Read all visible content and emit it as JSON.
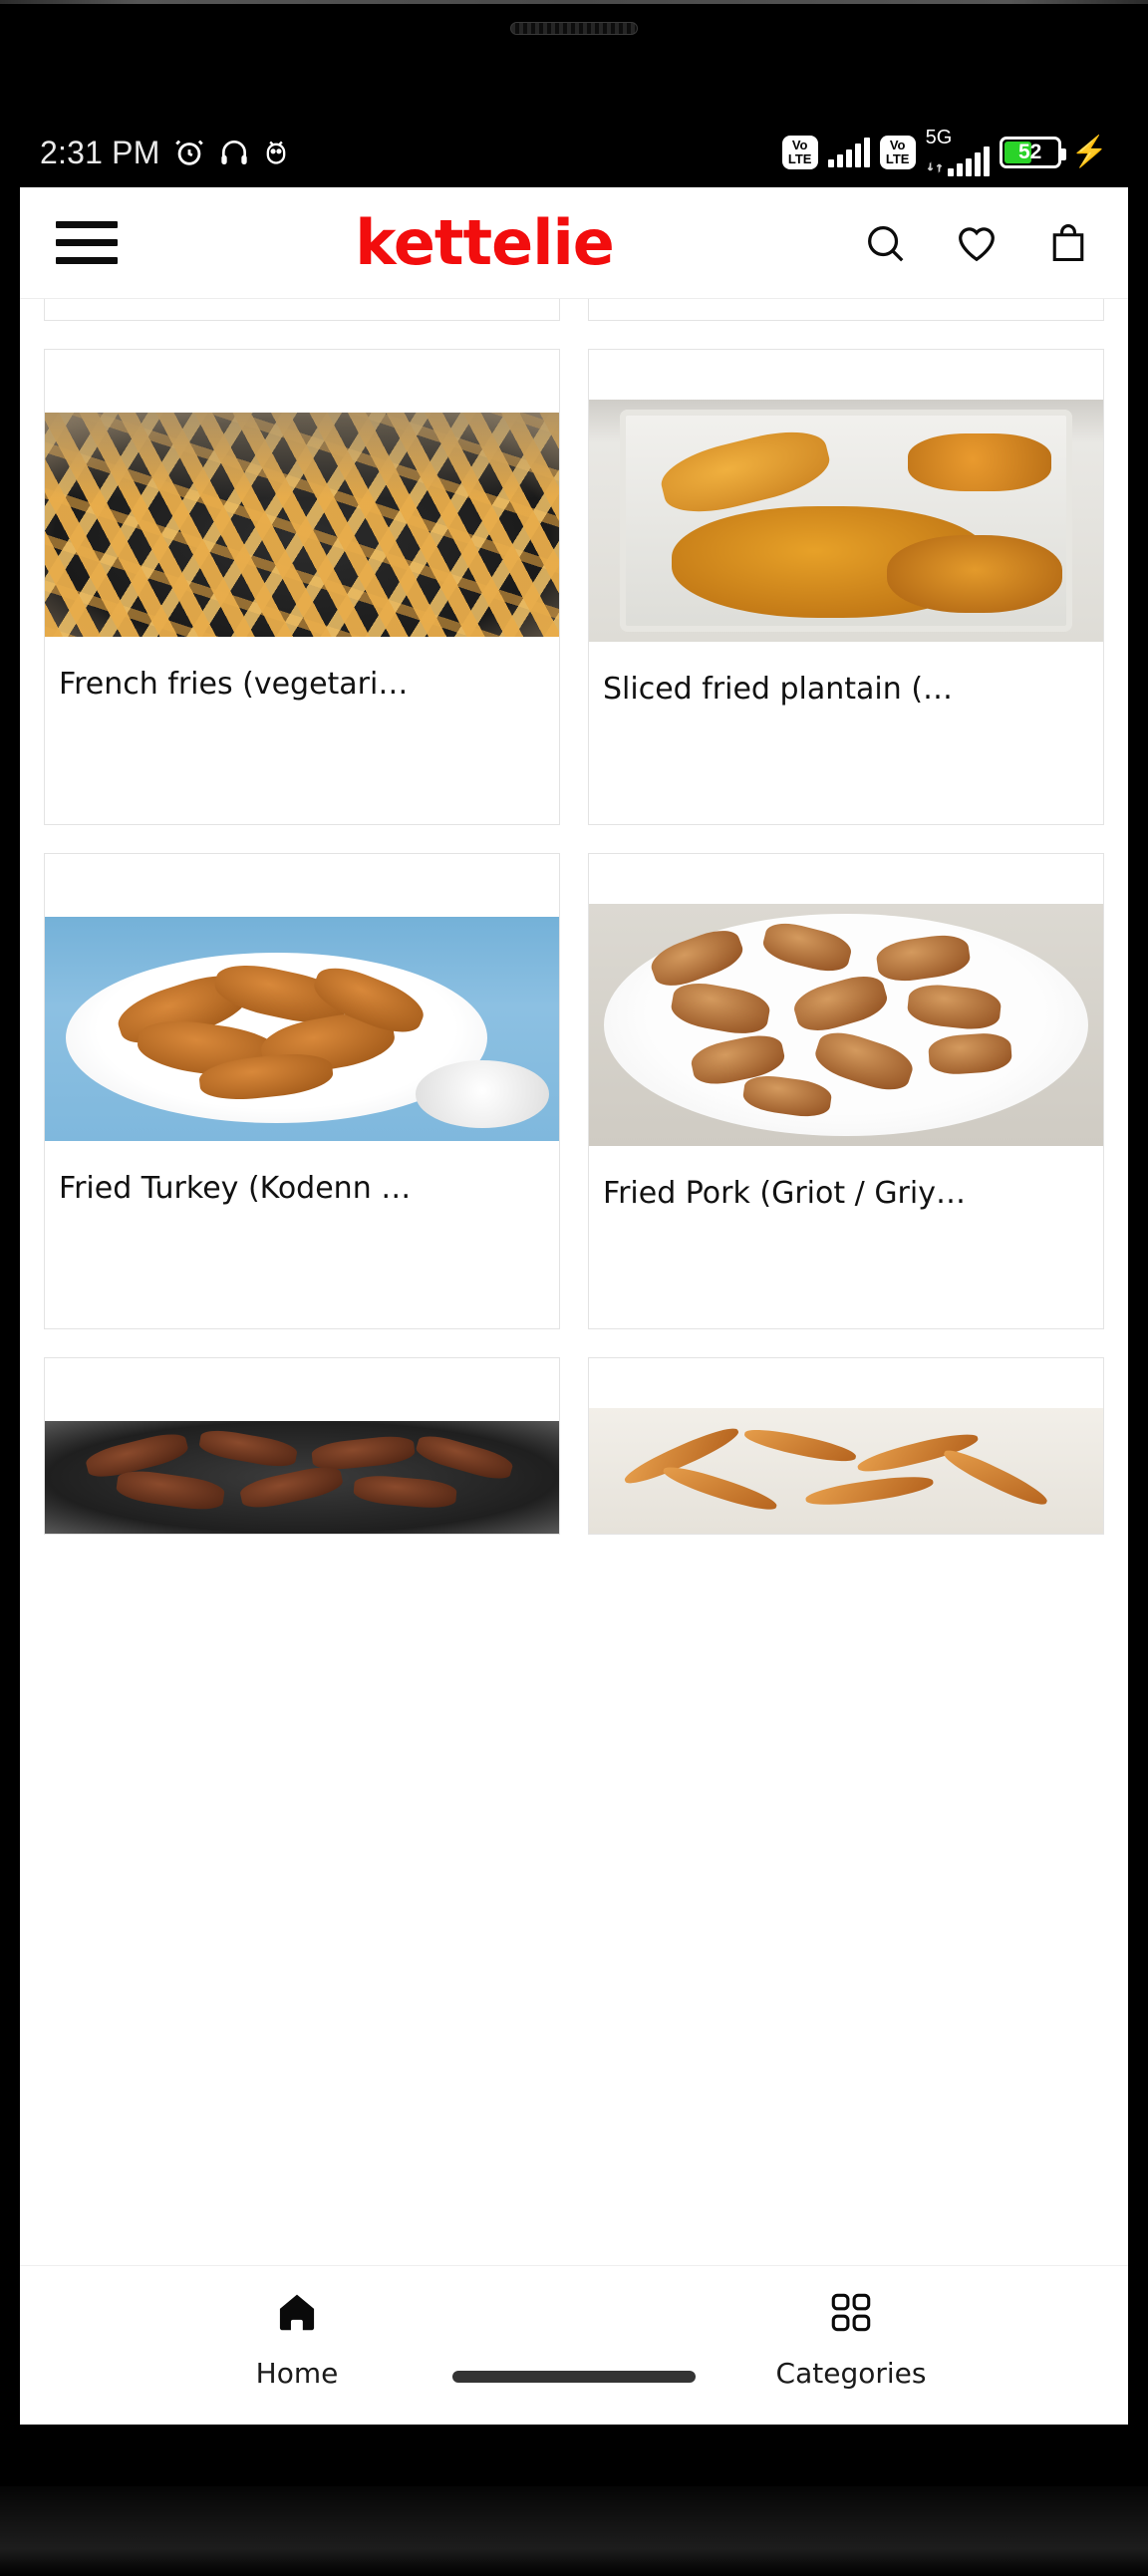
{
  "status_bar": {
    "time": "2:31 PM",
    "left_icons": [
      "alarm-clock-icon",
      "headphones-icon",
      "android-debug-icon"
    ],
    "sim1_network": "VoLTE",
    "sim2_network": "VoLTE",
    "data_network": "5G",
    "battery_percent": "52",
    "battery_charging": true,
    "battery_color": "#2ad328"
  },
  "app": {
    "brand": "kettelie",
    "brand_color": "#f20d0d",
    "menu_icon": "hamburger-menu-icon",
    "actions": [
      {
        "name": "search-icon",
        "label": "Search"
      },
      {
        "name": "heart-icon",
        "label": "Wishlist"
      },
      {
        "name": "shopping-bag-icon",
        "label": "Cart"
      }
    ]
  },
  "products": [
    {
      "title": "French fries (vegetari…",
      "image": "fries"
    },
    {
      "title": "Sliced fried plantain (…",
      "image": "plantain"
    },
    {
      "title": "Fried Turkey (Kodenn …",
      "image": "chicken"
    },
    {
      "title": "Fried Pork (Griot / Griy…",
      "image": "pork"
    },
    {
      "title": "",
      "image": "beef"
    },
    {
      "title": "",
      "image": "wings"
    }
  ],
  "bottom_nav": {
    "items": [
      {
        "label": "Home",
        "icon": "home-icon",
        "active": true
      },
      {
        "label": "Categories",
        "icon": "grid-categories-icon",
        "active": false
      }
    ]
  }
}
